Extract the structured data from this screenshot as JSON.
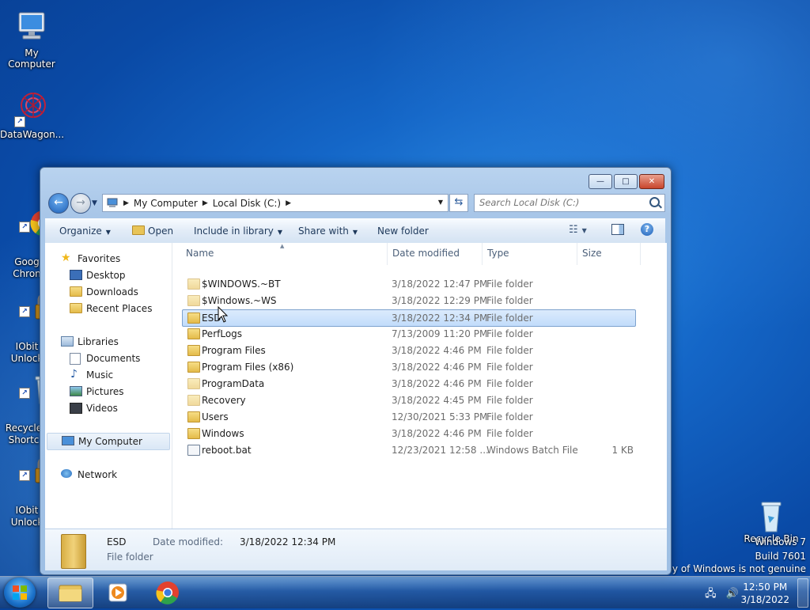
{
  "desktop": {
    "icons": [
      {
        "label": "My Computer"
      },
      {
        "label": "DataWagon..."
      },
      {
        "label": "Goog\nChron"
      },
      {
        "label": "IObit\nUnlock"
      },
      {
        "label": "Recycle\nShortc"
      },
      {
        "label": "IObit\nUnlock"
      },
      {
        "label": "Recycle Bin"
      }
    ],
    "watermark": {
      "line1": "Windows 7",
      "line2": "Build 7601",
      "line3": "copy of Windows is not genuine"
    }
  },
  "window": {
    "controls": {
      "minimize": "—",
      "maximize": "□",
      "close": "✕"
    },
    "address": {
      "segments": [
        "My Computer",
        "Local Disk (C:)"
      ]
    },
    "search_placeholder": "Search Local Disk (C:)",
    "toolbar": {
      "organize": "Organize",
      "open": "Open",
      "include": "Include in library",
      "share": "Share with",
      "new_folder": "New folder"
    },
    "navpane": {
      "favorites": "Favorites",
      "desktop": "Desktop",
      "downloads": "Downloads",
      "recent": "Recent Places",
      "libraries": "Libraries",
      "documents": "Documents",
      "music": "Music",
      "pictures": "Pictures",
      "videos": "Videos",
      "mycomputer": "My Computer",
      "network": "Network"
    },
    "columns": {
      "name": "Name",
      "date": "Date modified",
      "type": "Type",
      "size": "Size"
    },
    "files": [
      {
        "name": "$WINDOWS.~BT",
        "date": "3/18/2022 12:47 PM",
        "type": "File folder",
        "size": ""
      },
      {
        "name": "$Windows.~WS",
        "date": "3/18/2022 12:29 PM",
        "type": "File folder",
        "size": ""
      },
      {
        "name": "ESD",
        "date": "3/18/2022 12:34 PM",
        "type": "File folder",
        "size": ""
      },
      {
        "name": "PerfLogs",
        "date": "7/13/2009 11:20 PM",
        "type": "File folder",
        "size": ""
      },
      {
        "name": "Program Files",
        "date": "3/18/2022 4:46 PM",
        "type": "File folder",
        "size": ""
      },
      {
        "name": "Program Files (x86)",
        "date": "3/18/2022 4:46 PM",
        "type": "File folder",
        "size": ""
      },
      {
        "name": "ProgramData",
        "date": "3/18/2022 4:46 PM",
        "type": "File folder",
        "size": ""
      },
      {
        "name": "Recovery",
        "date": "3/18/2022 4:45 PM",
        "type": "File folder",
        "size": ""
      },
      {
        "name": "Users",
        "date": "12/30/2021 5:33 PM",
        "type": "File folder",
        "size": ""
      },
      {
        "name": "Windows",
        "date": "3/18/2022 4:46 PM",
        "type": "File folder",
        "size": ""
      },
      {
        "name": "reboot.bat",
        "date": "12/23/2021 12:58 ...",
        "type": "Windows Batch File",
        "size": "1 KB"
      }
    ],
    "details": {
      "name": "ESD",
      "date_label": "Date modified:",
      "date_value": "3/18/2022 12:34 PM",
      "type": "File folder"
    }
  },
  "taskbar": {
    "time": "12:50 PM",
    "date": "3/18/2022"
  }
}
